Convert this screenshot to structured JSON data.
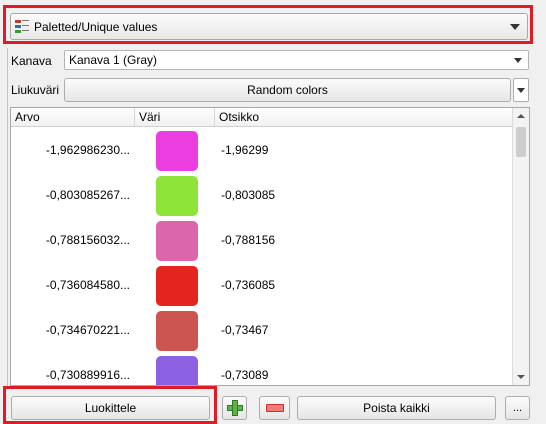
{
  "renderer": {
    "selected": "Paletted/Unique values"
  },
  "band": {
    "label": "Kanava",
    "selected": "Kanava 1 (Gray)"
  },
  "ramp": {
    "label": "Liukuväri",
    "button_label": "Random colors"
  },
  "table": {
    "headers": {
      "value": "Arvo",
      "color": "Väri",
      "label": "Otsikko"
    },
    "rows": [
      {
        "value": "-1,962986230...",
        "color": "#ec3de0",
        "label": "-1,96299"
      },
      {
        "value": "-0,803085267...",
        "color": "#8fe43a",
        "label": "-0,803085"
      },
      {
        "value": "-0,788156032...",
        "color": "#dc66ac",
        "label": "-0,788156"
      },
      {
        "value": "-0,736084580...",
        "color": "#e3241f",
        "label": "-0,736085"
      },
      {
        "value": "-0,734670221...",
        "color": "#cd5550",
        "label": "-0,73467"
      },
      {
        "value": "-0,730889916...",
        "color": "#8c62e3",
        "label": "-0,73089"
      }
    ]
  },
  "buttons": {
    "classify": "Luokittele",
    "add_icon": "add-plus-icon",
    "remove_icon": "remove-minus-icon",
    "delete_all": "Poista kaikki",
    "more": "..."
  },
  "highlight_color": "#e01b24"
}
